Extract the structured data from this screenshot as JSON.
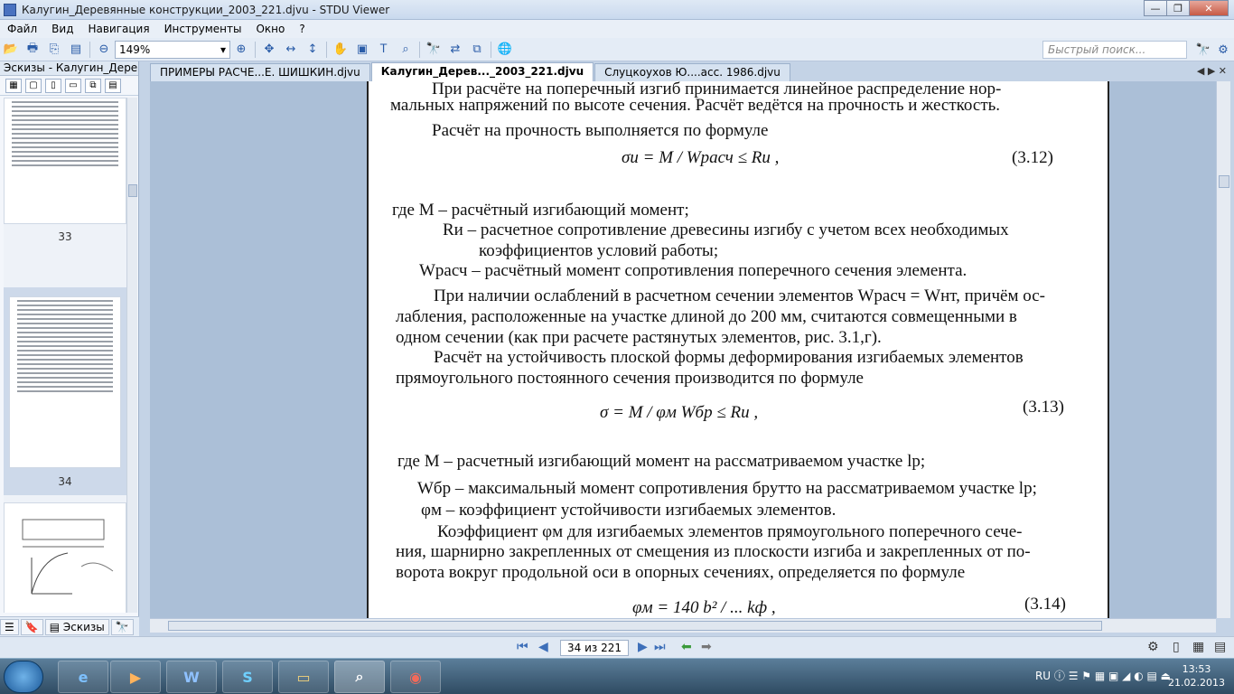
{
  "window": {
    "title": "Калугин_Деревянные конструкции_2003_221.djvu - STDU Viewer"
  },
  "menu": [
    "Файл",
    "Вид",
    "Навигация",
    "Инструменты",
    "Окно",
    "?"
  ],
  "toolbar": {
    "zoom": "149%",
    "search_placeholder": "Быстрый поиск..."
  },
  "sidebar": {
    "title": "Эскизы - Калугин_Деревянн",
    "page_labels": [
      "33",
      "34"
    ],
    "tabs": [
      "Эскизы"
    ]
  },
  "tabs": [
    {
      "label": "ПРИМЕРЫ РАСЧЕ...Е. ШИШКИН.djvu"
    },
    {
      "label": "Калугин_Дерев..._2003_221.djvu"
    },
    {
      "label": "Слуцкоухов Ю....асс. 1986.djvu"
    }
  ],
  "document": {
    "lines": [
      "При расчёте на поперечный изгиб принимается линейное распределение нор-",
      "мальных напряжений по высоте сечения. Расчёт ведётся на прочность и жесткость.",
      "Расчёт на прочность выполняется по формуле",
      "где      M – расчётный изгибающий момент;",
      "Rи – расчетное сопротивление древесины изгибу с учетом всех необходимых",
      "коэффициентов условий работы;",
      "Wрасч – расчётный момент сопротивления поперечного сечения элемента.",
      "При наличии ослаблений в расчетном сечении элементов Wрасч = Wнт, причём ос-",
      "лабления, расположенные на участке длиной до 200 мм, считаются совмещенными в",
      "одном сечении (как при расчете растянутых элементов, рис. 3.1,г).",
      "Расчёт на устойчивость плоской формы деформирования изгибаемых элементов",
      "прямоугольного постоянного сечения производится по формуле",
      "где M   – расчетный изгибающий момент на рассматриваемом участке lр;",
      "Wбр – максимальный момент сопротивления брутто на рассматриваемом участке lр;",
      "φм – коэффициент устойчивости изгибаемых элементов.",
      "Коэффициент φм для изгибаемых элементов прямоугольного поперечного сече-",
      "ния, шарнирно закрепленных от смещения из плоскости изгиба и закрепленных от по-",
      "ворота вокруг продольной оси в опорных сечениях, определяется по формуле"
    ],
    "formulas": {
      "f312": "σи = M / Wрасч ≤ Rи ,",
      "f313": "σ = M / φм Wбр ≤ Rи ,",
      "f314": "φм = 140 b² / ... kф ,"
    },
    "equation_numbers": [
      "(3.12)",
      "(3.13)",
      "(3.14)"
    ]
  },
  "status": {
    "page_indicator": "34 из 221"
  },
  "taskbar": {
    "lang": "RU",
    "time": "13:53",
    "date": "21.02.2013"
  }
}
